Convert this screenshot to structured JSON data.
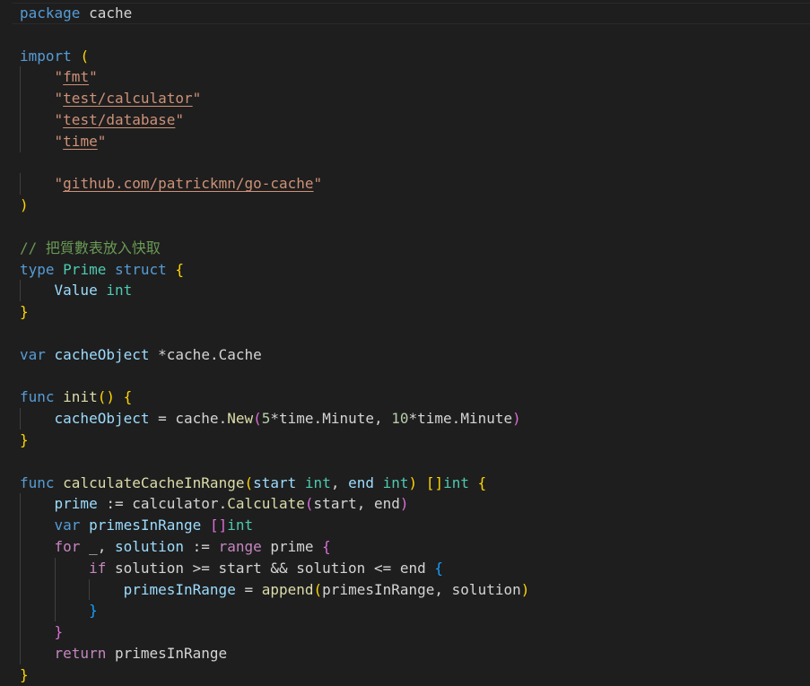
{
  "editor": {
    "language": "go",
    "theme_colors": {
      "background": "#1e1e1e",
      "keyword": "#569cd6",
      "control": "#c586c0",
      "identifier": "#9cdcfe",
      "type": "#4ec9b0",
      "function": "#dcdcaa",
      "string": "#ce9178",
      "number": "#b5cea8",
      "comment": "#6a9955",
      "bracket_1": "#ffd700",
      "bracket_2": "#da70d6",
      "bracket_3": "#179fff"
    },
    "lines": [
      [
        [
          "kw-blue",
          "package"
        ],
        [
          "plain",
          " cache"
        ]
      ],
      [],
      [
        [
          "kw-blue",
          "import"
        ],
        [
          "plain",
          " "
        ],
        [
          "b-yellow",
          "("
        ]
      ],
      [
        [
          "plain",
          "    "
        ],
        [
          "string",
          "\""
        ],
        [
          "str-link",
          "fmt"
        ],
        [
          "string",
          "\""
        ]
      ],
      [
        [
          "plain",
          "    "
        ],
        [
          "string",
          "\""
        ],
        [
          "str-link",
          "test/calculator"
        ],
        [
          "string",
          "\""
        ]
      ],
      [
        [
          "plain",
          "    "
        ],
        [
          "string",
          "\""
        ],
        [
          "str-link",
          "test/database"
        ],
        [
          "string",
          "\""
        ]
      ],
      [
        [
          "plain",
          "    "
        ],
        [
          "string",
          "\""
        ],
        [
          "str-link",
          "time"
        ],
        [
          "string",
          "\""
        ]
      ],
      [],
      [
        [
          "plain",
          "    "
        ],
        [
          "string",
          "\""
        ],
        [
          "str-link",
          "github.com/patrickmn/go-cache"
        ],
        [
          "string",
          "\""
        ]
      ],
      [
        [
          "b-yellow",
          ")"
        ]
      ],
      [],
      [
        [
          "comment",
          "// 把質數表放入快取"
        ]
      ],
      [
        [
          "kw-blue",
          "type"
        ],
        [
          "plain",
          " "
        ],
        [
          "type",
          "Prime"
        ],
        [
          "plain",
          " "
        ],
        [
          "kw-blue",
          "struct"
        ],
        [
          "plain",
          " "
        ],
        [
          "b-yellow",
          "{"
        ]
      ],
      [
        [
          "plain",
          "    "
        ],
        [
          "ident",
          "Value"
        ],
        [
          "plain",
          " "
        ],
        [
          "type",
          "int"
        ]
      ],
      [
        [
          "b-yellow",
          "}"
        ]
      ],
      [],
      [
        [
          "kw-blue",
          "var"
        ],
        [
          "plain",
          " "
        ],
        [
          "ident",
          "cacheObject"
        ],
        [
          "plain",
          " *cache.Cache"
        ]
      ],
      [],
      [
        [
          "kw-blue",
          "func"
        ],
        [
          "plain",
          " "
        ],
        [
          "func",
          "init"
        ],
        [
          "b-yellow",
          "()"
        ],
        [
          "plain",
          " "
        ],
        [
          "b-yellow",
          "{"
        ]
      ],
      [
        [
          "plain",
          "    "
        ],
        [
          "ident",
          "cacheObject"
        ],
        [
          "plain",
          " = cache."
        ],
        [
          "func",
          "New"
        ],
        [
          "b-purple",
          "("
        ],
        [
          "number",
          "5"
        ],
        [
          "plain",
          "*time.Minute, "
        ],
        [
          "number",
          "10"
        ],
        [
          "plain",
          "*time.Minute"
        ],
        [
          "b-purple",
          ")"
        ]
      ],
      [
        [
          "b-yellow",
          "}"
        ]
      ],
      [],
      [
        [
          "kw-blue",
          "func"
        ],
        [
          "plain",
          " "
        ],
        [
          "func",
          "calculateCacheInRange"
        ],
        [
          "b-yellow",
          "("
        ],
        [
          "ident",
          "start"
        ],
        [
          "plain",
          " "
        ],
        [
          "type",
          "int"
        ],
        [
          "plain",
          ", "
        ],
        [
          "ident",
          "end"
        ],
        [
          "plain",
          " "
        ],
        [
          "type",
          "int"
        ],
        [
          "b-yellow",
          ")"
        ],
        [
          "plain",
          " "
        ],
        [
          "b-yellow",
          "[]"
        ],
        [
          "type",
          "int"
        ],
        [
          "plain",
          " "
        ],
        [
          "b-yellow",
          "{"
        ]
      ],
      [
        [
          "plain",
          "    "
        ],
        [
          "ident",
          "prime"
        ],
        [
          "plain",
          " := calculator."
        ],
        [
          "func",
          "Calculate"
        ],
        [
          "b-purple",
          "("
        ],
        [
          "plain",
          "start, end"
        ],
        [
          "b-purple",
          ")"
        ]
      ],
      [
        [
          "plain",
          "    "
        ],
        [
          "kw-blue",
          "var"
        ],
        [
          "plain",
          " "
        ],
        [
          "ident",
          "primesInRange"
        ],
        [
          "plain",
          " "
        ],
        [
          "b-purple",
          "[]"
        ],
        [
          "type",
          "int"
        ]
      ],
      [
        [
          "plain",
          "    "
        ],
        [
          "kw-purple",
          "for"
        ],
        [
          "plain",
          " _, "
        ],
        [
          "ident",
          "solution"
        ],
        [
          "plain",
          " := "
        ],
        [
          "kw-purple",
          "range"
        ],
        [
          "plain",
          " prime "
        ],
        [
          "b-purple",
          "{"
        ]
      ],
      [
        [
          "plain",
          "        "
        ],
        [
          "kw-purple",
          "if"
        ],
        [
          "plain",
          " solution >= start && solution <= end "
        ],
        [
          "b-blue",
          "{"
        ]
      ],
      [
        [
          "plain",
          "            "
        ],
        [
          "ident",
          "primesInRange"
        ],
        [
          "plain",
          " = "
        ],
        [
          "func",
          "append"
        ],
        [
          "b-yellow",
          "("
        ],
        [
          "plain",
          "primesInRange, solution"
        ],
        [
          "b-yellow",
          ")"
        ]
      ],
      [
        [
          "plain",
          "        "
        ],
        [
          "b-blue",
          "}"
        ]
      ],
      [
        [
          "plain",
          "    "
        ],
        [
          "b-purple",
          "}"
        ]
      ],
      [
        [
          "plain",
          "    "
        ],
        [
          "kw-purple",
          "return"
        ],
        [
          "plain",
          " primesInRange"
        ]
      ],
      [
        [
          "b-yellow",
          "}"
        ]
      ]
    ]
  }
}
